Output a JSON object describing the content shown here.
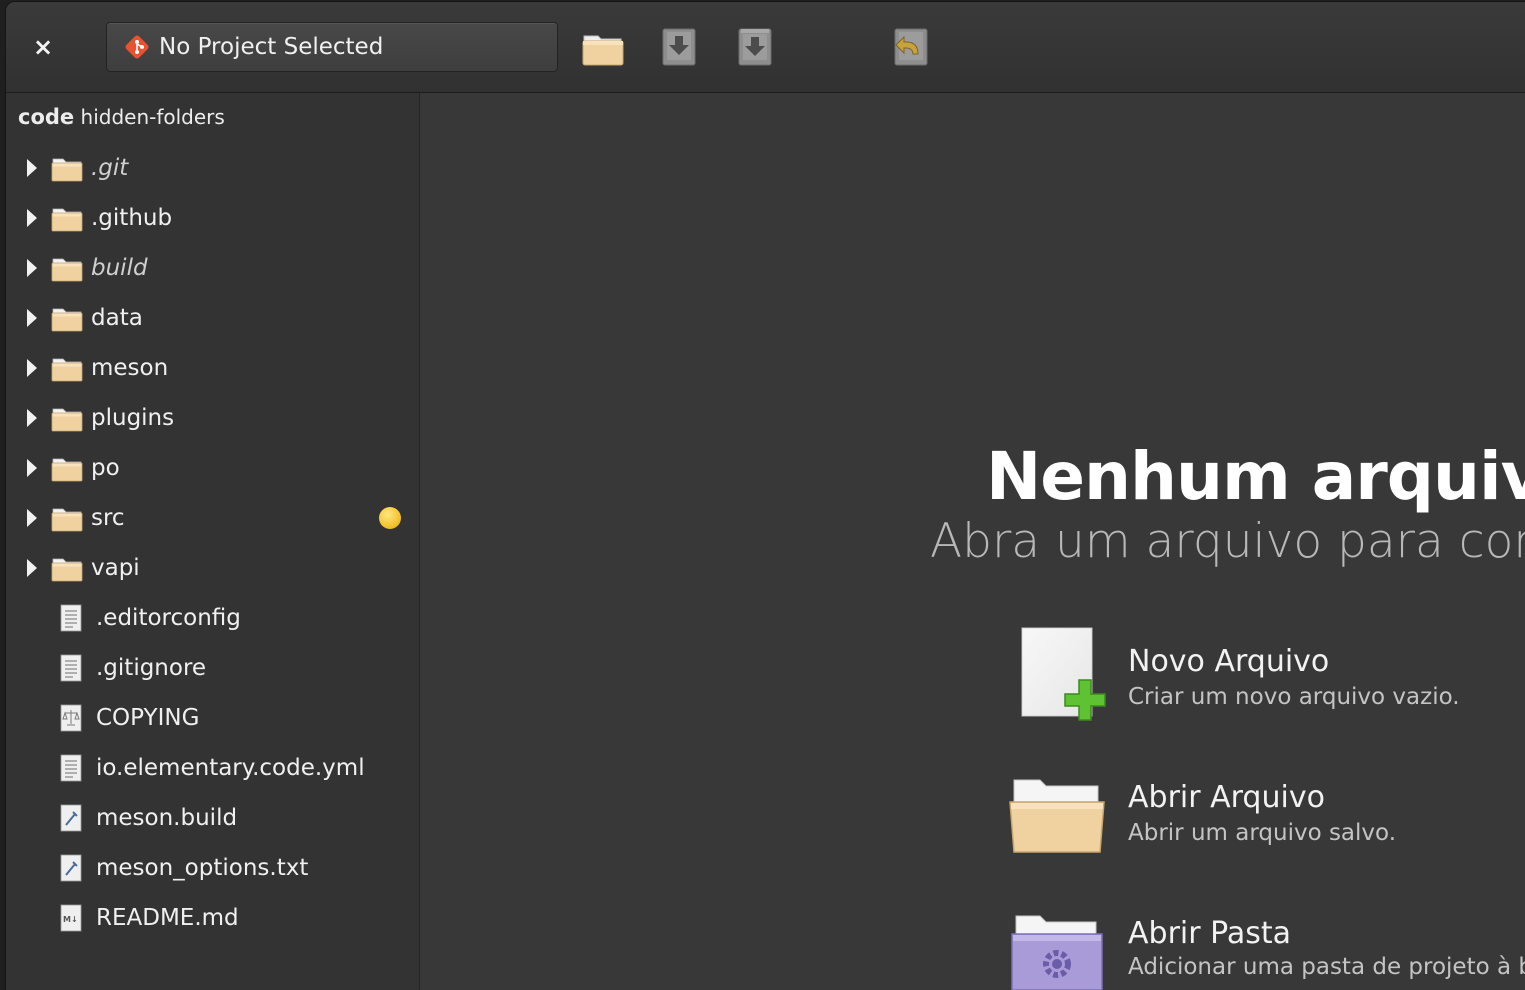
{
  "header": {
    "close_label": "×",
    "project_label": "No Project Selected",
    "toolbar_icons": [
      "open-folder-icon",
      "save-icon",
      "save-as-icon",
      "undo-icon"
    ]
  },
  "sidebar": {
    "root_bold": "code",
    "root_name": "hidden-folders",
    "items": [
      {
        "label": ".git",
        "type": "folder",
        "dim": true
      },
      {
        "label": ".github",
        "type": "folder"
      },
      {
        "label": "build",
        "type": "folder",
        "dim": true
      },
      {
        "label": "data",
        "type": "folder"
      },
      {
        "label": "meson",
        "type": "folder"
      },
      {
        "label": "plugins",
        "type": "folder"
      },
      {
        "label": "po",
        "type": "folder"
      },
      {
        "label": "src",
        "type": "folder",
        "badge": "#f4c430"
      },
      {
        "label": "vapi",
        "type": "folder"
      },
      {
        "label": ".editorconfig",
        "type": "text-file"
      },
      {
        "label": ".gitignore",
        "type": "text-file"
      },
      {
        "label": "COPYING",
        "type": "license-file"
      },
      {
        "label": "io.elementary.code.yml",
        "type": "text-file"
      },
      {
        "label": "meson.build",
        "type": "build-file"
      },
      {
        "label": "meson_options.txt",
        "type": "build-file"
      },
      {
        "label": "README.md",
        "type": "markdown-file"
      }
    ]
  },
  "welcome": {
    "title": "Nenhum arquivo a",
    "subtitle": "Abra um arquivo para começ",
    "actions": [
      {
        "title": "Novo Arquivo",
        "description": "Criar um novo arquivo vazio.",
        "icon": "new-file-icon"
      },
      {
        "title": "Abrir Arquivo",
        "description": "Abrir um arquivo salvo.",
        "icon": "open-file-icon"
      },
      {
        "title": "Abrir Pasta",
        "description": "Adicionar uma pasta de projeto à b",
        "icon": "open-project-folder-icon"
      }
    ]
  },
  "colors": {
    "window_bg": "#383838",
    "sidebar_bg": "#333333",
    "folder": "#f3d7a8",
    "badge": "#f4c430",
    "accent_green": "#5ec232",
    "project_folder": "#a99bd8"
  }
}
